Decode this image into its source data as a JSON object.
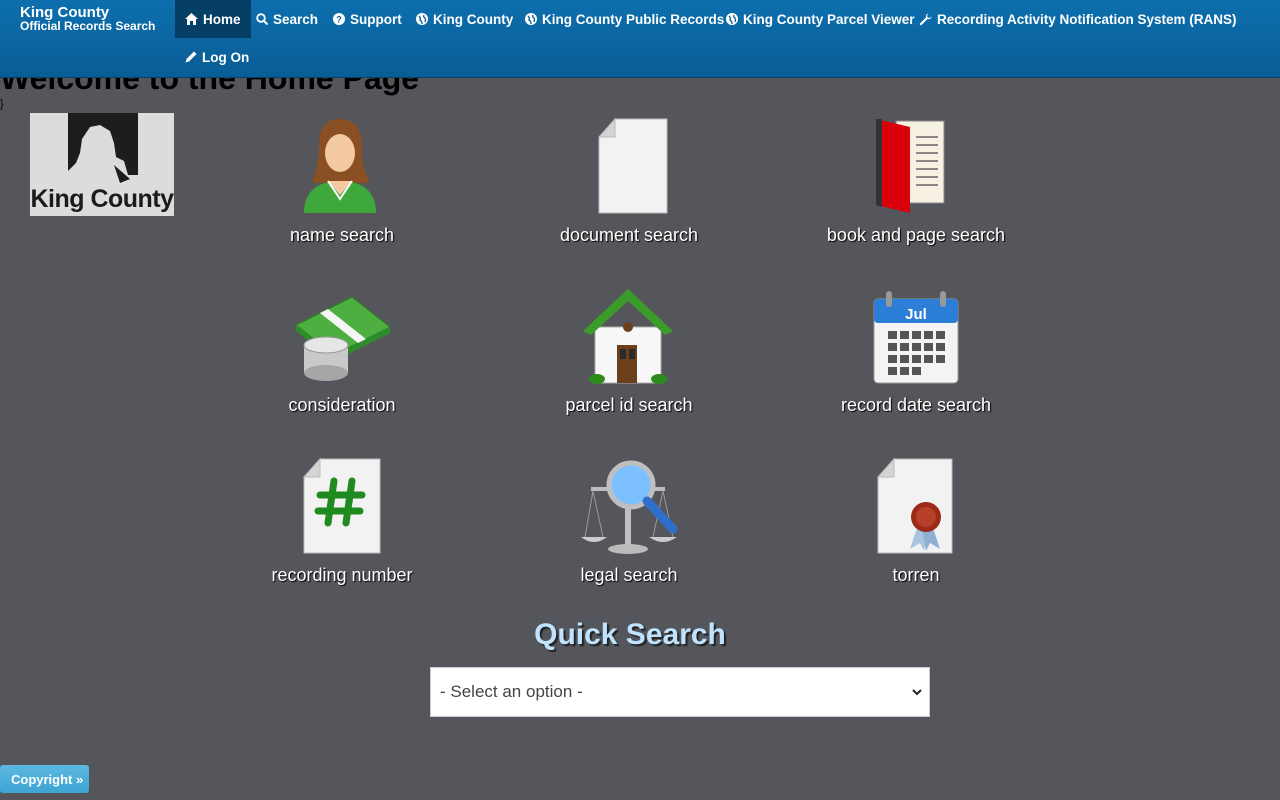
{
  "brand": {
    "line1": "King County",
    "line2": "Official Records Search"
  },
  "nav": {
    "home": "Home",
    "search": "Search",
    "support": "Support",
    "king_county": "King County",
    "public_records": "King County Public Records",
    "parcel_viewer": "King County Parcel Viewer",
    "rans": "Recording Activity Notification System (RANS)",
    "logon": "Log On"
  },
  "page": {
    "heading": "Welcome to the Home Page",
    "stray": "}"
  },
  "logo": {
    "text": "King County"
  },
  "tiles": [
    {
      "label": "name search",
      "icon": "person-icon"
    },
    {
      "label": "document search",
      "icon": "document-icon"
    },
    {
      "label": "book and page search",
      "icon": "book-icon"
    },
    {
      "label": "consideration",
      "icon": "money-icon"
    },
    {
      "label": "parcel id search",
      "icon": "house-icon"
    },
    {
      "label": "record date search",
      "icon": "calendar-icon"
    },
    {
      "label": "recording number",
      "icon": "hash-document-icon"
    },
    {
      "label": "legal search",
      "icon": "scales-magnifier-icon"
    },
    {
      "label": "torren",
      "icon": "sealed-document-icon"
    }
  ],
  "calendar": {
    "month": "Jul"
  },
  "quick_search": {
    "title": "Quick Search",
    "selected": "- Select an option -"
  },
  "footer": {
    "copyright": "Copyright »"
  }
}
